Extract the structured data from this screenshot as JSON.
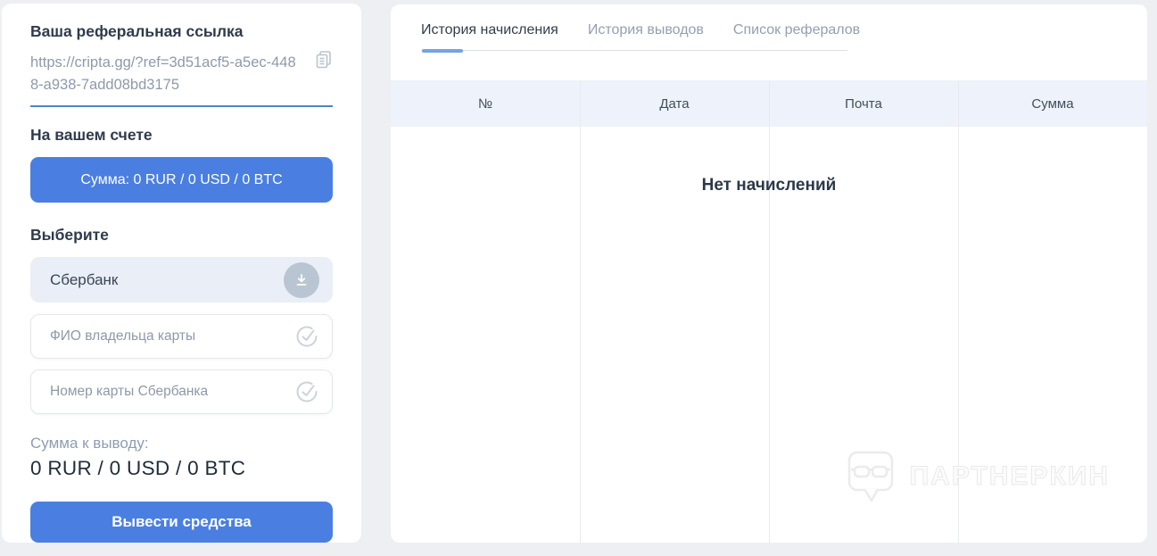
{
  "sidebar": {
    "referral_title": "Ваша реферальная ссылка",
    "referral_link": "https://cripta.gg/?ref=3d51acf5-a5ec-4488-a938-7add08bd3175",
    "account_title": "На вашем счете",
    "balance_label": "Сумма: 0 RUR / 0 USD / 0 BTC",
    "choose_title": "Выберите",
    "bank_selected": "Сбербанк",
    "card_owner_placeholder": "ФИО владельца карты",
    "card_number_placeholder": "Номер карты Сбербанка",
    "withdraw_sum_label": "Сумма к выводу:",
    "withdraw_sum_value": "0 RUR / 0 USD / 0 BTC",
    "withdraw_button_label": "Вывести средства"
  },
  "main": {
    "tabs": [
      {
        "label": "История начисления",
        "active": true
      },
      {
        "label": "История выводов",
        "active": false
      },
      {
        "label": "Список рефералов",
        "active": false
      }
    ],
    "table": {
      "headers": [
        "№",
        "Дата",
        "Почта",
        "Сумма"
      ],
      "rows": [],
      "empty_text": "Нет начислений"
    },
    "watermark_text": "ПАРТНЕРКИН"
  },
  "colors": {
    "accent_blue": "#4a7fe1",
    "link_underline_blue": "#4e84c4",
    "tab_underline_blue": "#74a4e2",
    "select_bg": "#e9eef7",
    "table_header_bg": "#eef2fa",
    "page_bg": "#edeff2"
  }
}
